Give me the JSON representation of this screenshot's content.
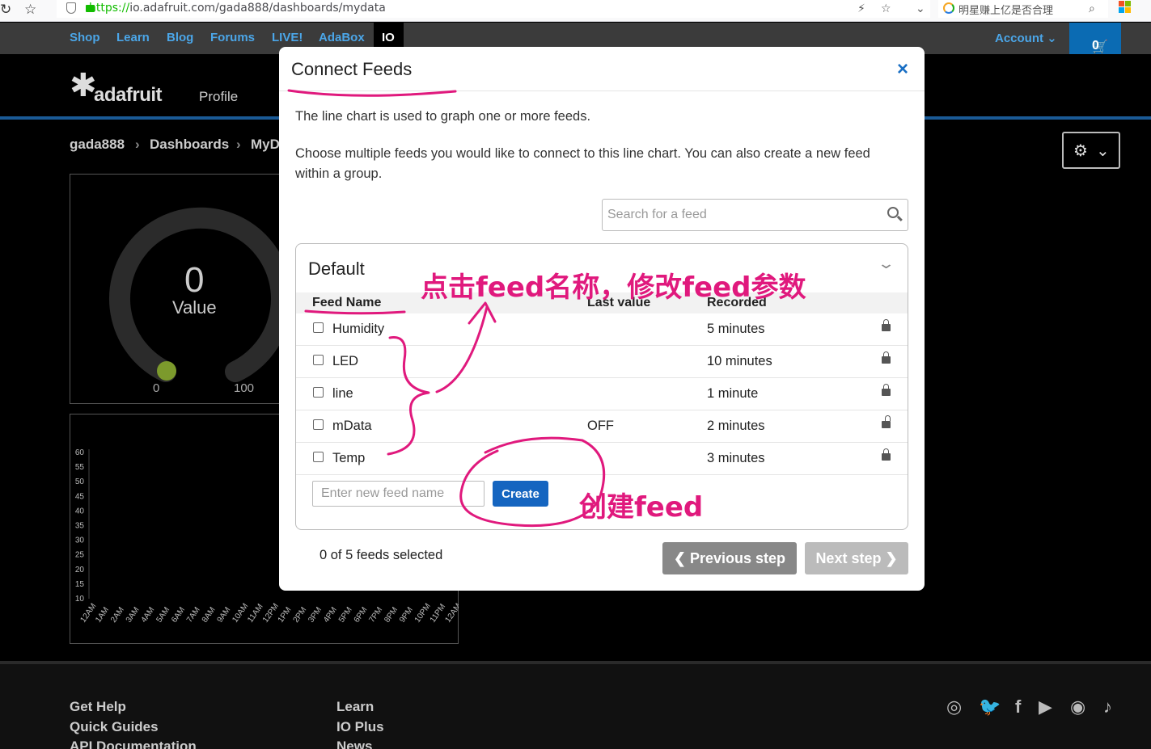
{
  "browser": {
    "url_scheme": "https://",
    "url_rest": "io.adafruit.com/gada888/dashboards/mydata",
    "side_search": "明星赚上亿是否合理"
  },
  "topnav": {
    "items": [
      "Shop",
      "Learn",
      "Blog",
      "Forums",
      "LIVE!",
      "AdaBox"
    ],
    "io_tab": "IO",
    "account": "Account ⌄",
    "cart": "0"
  },
  "header": {
    "logo": "adafruit",
    "profile": "Profile"
  },
  "breadcrumb": {
    "user": "gada888",
    "dashboards": "Dashboards",
    "current": "MyD"
  },
  "gauge": {
    "value": "0",
    "label": "Value",
    "min": "0",
    "max": "100"
  },
  "chart_data": {
    "type": "line",
    "title": "",
    "yticks": [
      "60",
      "55",
      "50",
      "45",
      "40",
      "35",
      "30",
      "25",
      "20",
      "15",
      "10"
    ],
    "xticks": [
      "12AM",
      "1AM",
      "2AM",
      "3AM",
      "4AM",
      "5AM",
      "6AM",
      "7AM",
      "8AM",
      "9AM",
      "10AM",
      "11AM",
      "12PM",
      "1PM",
      "2PM",
      "3PM",
      "4PM",
      "5PM",
      "6PM",
      "7PM",
      "8PM",
      "9PM",
      "10PM",
      "11PM",
      "12AM"
    ],
    "ylim": [
      10,
      60
    ],
    "series": []
  },
  "footer": {
    "col1": [
      "Get Help",
      "Quick Guides",
      "API Documentation"
    ],
    "col2": [
      "Learn",
      "IO Plus",
      "News"
    ]
  },
  "modal": {
    "title": "Connect Feeds",
    "close": "×",
    "desc1": "The line chart is used to graph one or more feeds.",
    "desc2": "Choose multiple feeds you would like to connect to this line chart. You can also create a new feed within a group.",
    "search_placeholder": "Search for a feed",
    "group": {
      "name": "Default",
      "columns": [
        "Feed Name",
        "Last value",
        "Recorded"
      ],
      "feeds": [
        {
          "name": "Humidity",
          "last": "",
          "recorded": "5 minutes",
          "locked": true
        },
        {
          "name": "LED",
          "last": "",
          "recorded": "10 minutes",
          "locked": true
        },
        {
          "name": "line",
          "last": "",
          "recorded": "1 minute",
          "locked": true
        },
        {
          "name": "mData",
          "last": "OFF",
          "recorded": "2 minutes",
          "locked": false
        },
        {
          "name": "Temp",
          "last": "",
          "recorded": "3 minutes",
          "locked": true
        }
      ],
      "new_feed_placeholder": "Enter new feed name",
      "create_label": "Create"
    },
    "selected_count": "0 of 5 feeds selected",
    "prev_label": "❮ Previous step",
    "next_label": "Next step ❯"
  },
  "annotations": {
    "top": "点击feed名称，修改feed参数",
    "bottom": "创建feed",
    "color": "#e0197d"
  }
}
